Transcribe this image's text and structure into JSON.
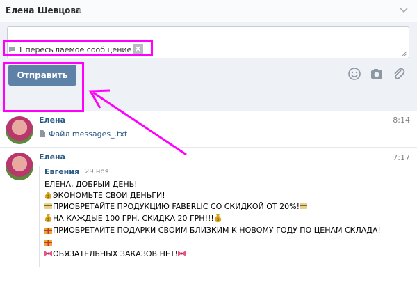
{
  "header": {
    "title": "Елена Шевцова"
  },
  "composer": {
    "forwarded_label": "1 пересылаемое сообщение",
    "forwarded_close": "×",
    "send_label": "Отправить"
  },
  "messages": [
    {
      "sender": "Елена",
      "time": "8:14",
      "file": "Файл messages_.txt"
    },
    {
      "sender": "Елена",
      "time": "7:17",
      "forwarded": {
        "sender": "Евгения",
        "date": "29 ноя",
        "lines": [
          "ЕЛЕНА, ДОБРЫЙ ДЕНЬ!",
          "ЭКОНОМЬТЕ СВОИ ДЕНЬГИ!",
          "ПРИОБРЕТАЙТЕ ПРОДУКЦИЮ FABERLIC СО СКИДКОЙ ОТ 20%!",
          "НА КАЖДЫЕ 100 ГРН. СКИДКА 20 ГРН!!!",
          "ПРИОБРЕТАЙТЕ ПОДАРКИ СВОИМ БЛИЗКИМ К НОВОМУ ГОДУ ПО ЦЕНАМ СКЛАДА!",
          "",
          "ОБЯЗАТЕЛЬНЫХ ЗАКАЗОВ НЕТ!"
        ]
      }
    }
  ],
  "colors": {
    "accent": "#5e81a8",
    "link": "#2a5885",
    "highlight": "#ff00ff"
  },
  "icons": [
    "chevron-down-icon",
    "forward-icon",
    "close-icon",
    "smile-icon",
    "camera-icon",
    "paperclip-icon",
    "file-icon",
    "money-bag-icon",
    "credit-card-icon",
    "gift-icon",
    "bow-icon"
  ]
}
